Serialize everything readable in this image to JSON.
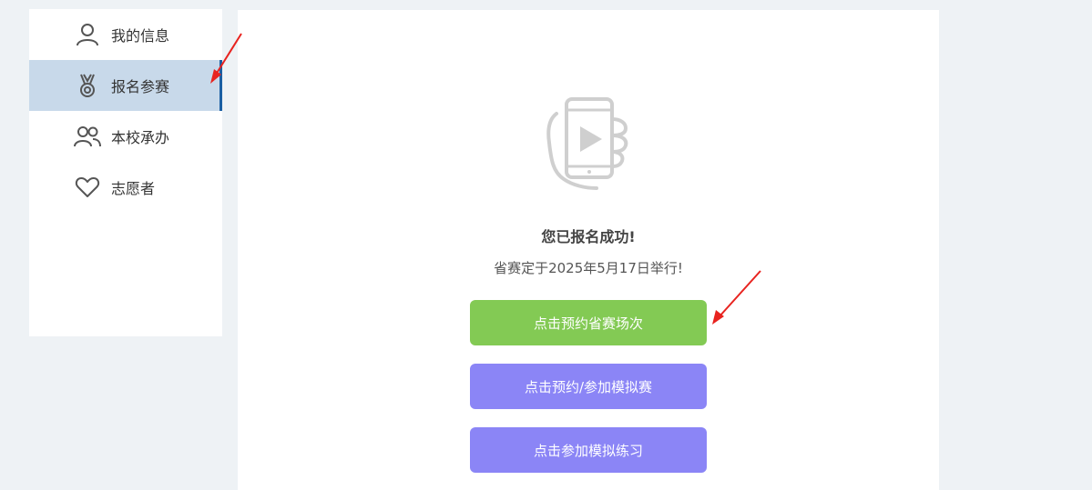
{
  "sidebar": {
    "items": [
      {
        "label": "我的信息",
        "icon": "user-icon",
        "active": false
      },
      {
        "label": "报名参赛",
        "icon": "medal-icon",
        "active": true
      },
      {
        "label": "本校承办",
        "icon": "users-icon",
        "active": false
      },
      {
        "label": "志愿者",
        "icon": "heart-icon",
        "active": false
      }
    ]
  },
  "main": {
    "illustration_icon": "phone-video-icon",
    "success_title": "您已报名成功!",
    "success_subtitle": "省赛定于2025年5月17日举行!",
    "buttons": {
      "reserve_provincial": "点击预约省赛场次",
      "reserve_mock": "点击预约/参加模拟赛",
      "join_practice": "点击参加模拟练习"
    }
  },
  "colors": {
    "page_bg": "#eef2f5",
    "active_bg": "#c8d9ea",
    "active_border": "#1b5fa3",
    "green_button": "#83ca54",
    "purple_button": "#8b85f6",
    "annotation_arrow": "#e8231f"
  }
}
